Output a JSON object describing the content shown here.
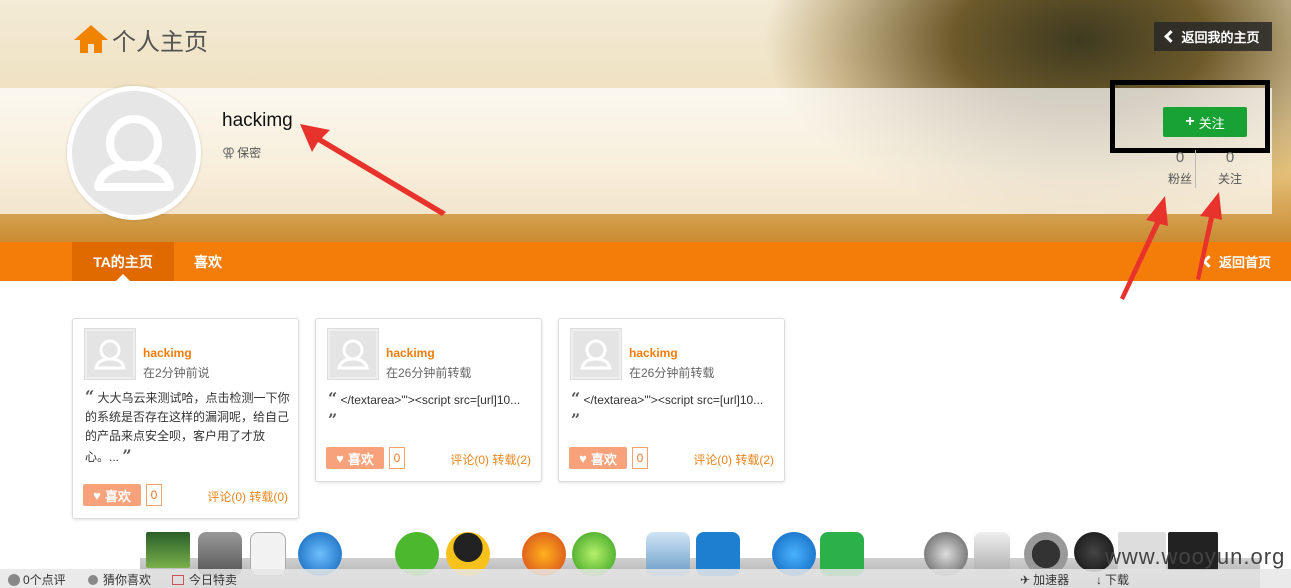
{
  "header": {
    "title": "个人主页",
    "back_my_home": "返回我的主页"
  },
  "profile": {
    "username": "hackimg",
    "gender": "保密",
    "follow_button": "关注",
    "stats": [
      {
        "count": "0",
        "label": "粉丝"
      },
      {
        "count": "0",
        "label": "关注"
      }
    ]
  },
  "nav": {
    "tabs": [
      {
        "label": "TA的主页",
        "active": true
      },
      {
        "label": "喜欢",
        "active": false
      }
    ],
    "back_home": "返回首页"
  },
  "cards": [
    {
      "username": "hackimg",
      "time": "在2分钟前说",
      "content": "大大乌云来测试哈，点击检测一下你的系统是否存在这样的漏洞呢，给自己的产品来点安全呗，客户用了才放心。...",
      "like_label": "喜欢",
      "like_count": "0",
      "links": "评论(0) 转载(0)"
    },
    {
      "username": "hackimg",
      "time": "在26分钟前转载",
      "content": "</textarea>'\"><script src=[url]10...",
      "like_label": "喜欢",
      "like_count": "0",
      "links": "评论(0) 转载(2)"
    },
    {
      "username": "hackimg",
      "time": "在26分钟前转载",
      "content": "</textarea>'\"><script src=[url]10...",
      "like_label": "喜欢",
      "like_count": "0",
      "links": "评论(0) 转载(2)"
    }
  ],
  "taskbar": {
    "comments": "0个点评",
    "guess_like": "猜你喜欢",
    "daily_deal": "今日特卖",
    "accelerator": "加速器",
    "download": "下载"
  },
  "watermark": "www.wooyun.org",
  "colors": {
    "accent": "#f47d0a",
    "follow_green": "#18a233",
    "like_bg": "#f8a27c"
  }
}
